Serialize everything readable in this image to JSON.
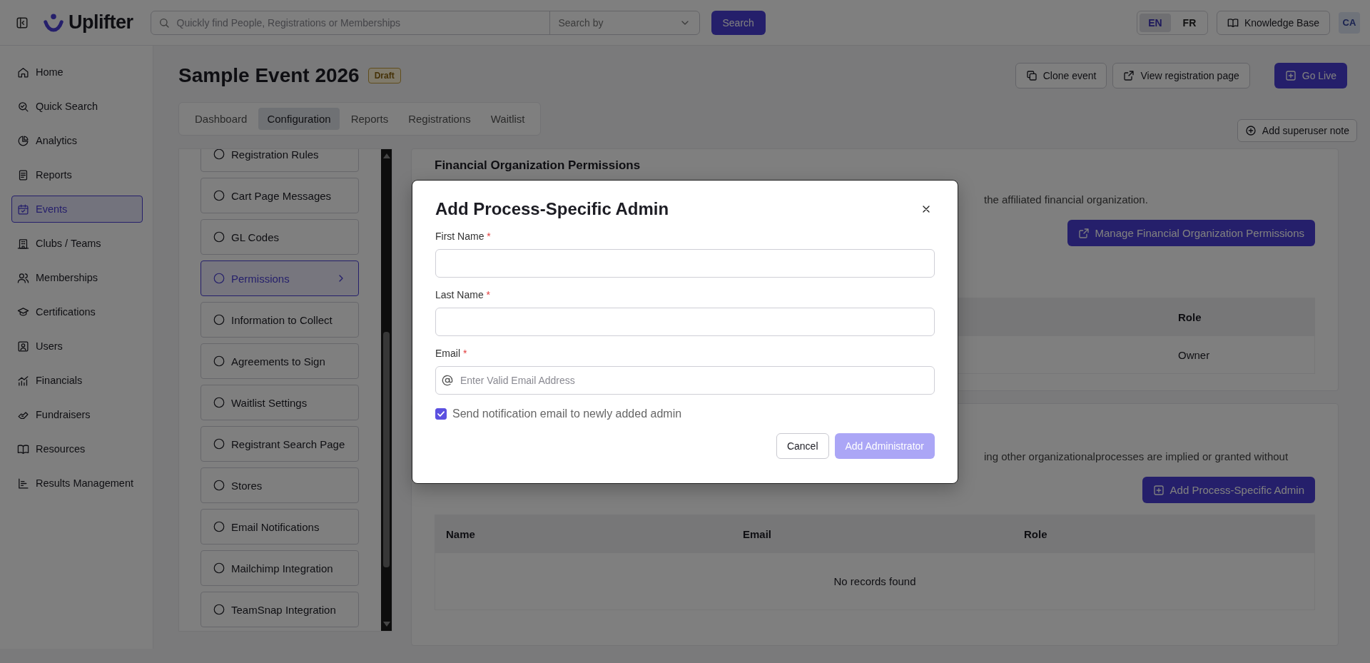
{
  "top_bar": {
    "logo": "Uplifter",
    "search": {
      "placeholder": "Quickly find People, Registrations or Memberships"
    },
    "search_by": {
      "placeholder": "Search by"
    },
    "search_button": "Search",
    "languages": [
      {
        "label": "EN",
        "selected": true
      },
      {
        "label": "FR",
        "selected": false
      }
    ],
    "help_link": "Knowledge Base",
    "avatar": "CA"
  },
  "sidebar": {
    "items": [
      {
        "label": "Home",
        "selected": false
      },
      {
        "label": "Quick Search",
        "selected": false
      },
      {
        "label": "Analytics",
        "selected": false
      },
      {
        "label": "Reports",
        "selected": false
      },
      {
        "label": "Events",
        "selected": true
      },
      {
        "label": "Clubs / Teams",
        "selected": false
      },
      {
        "label": "Memberships",
        "selected": false
      },
      {
        "label": "Certifications",
        "selected": false
      },
      {
        "label": "Users",
        "selected": false
      },
      {
        "label": "Financials",
        "selected": false
      },
      {
        "label": "Fundraisers",
        "selected": false
      },
      {
        "label": "Resources",
        "selected": false
      },
      {
        "label": "Results Management",
        "selected": false
      }
    ]
  },
  "event": {
    "title": "Sample Event 2026",
    "status": "Draft",
    "actions": [
      {
        "label": "Clone event",
        "kind": "clone"
      },
      {
        "label": "View registration page",
        "kind": "external"
      },
      {
        "label": "Go Live",
        "kind": "primary"
      }
    ],
    "tabs": [
      {
        "label": "Dashboard",
        "selected": false
      },
      {
        "label": "Configuration",
        "selected": true
      },
      {
        "label": "Reports",
        "selected": false
      },
      {
        "label": "Registrations",
        "selected": false
      },
      {
        "label": "Waitlist",
        "selected": false
      }
    ],
    "note_button": "Add superuser note"
  },
  "config_menu": {
    "items": [
      {
        "label": "Registration Rules",
        "selected": false
      },
      {
        "label": "Cart Page Messages",
        "selected": false
      },
      {
        "label": "GL Codes",
        "selected": false
      },
      {
        "label": "Permissions",
        "selected": true
      },
      {
        "label": "Information to Collect",
        "selected": false
      },
      {
        "label": "Agreements to Sign",
        "selected": false
      },
      {
        "label": "Waitlist Settings",
        "selected": false
      },
      {
        "label": "Registrant Search Page",
        "selected": false
      },
      {
        "label": "Stores",
        "selected": false
      },
      {
        "label": "Email Notifications",
        "selected": false
      },
      {
        "label": "Mailchimp Integration",
        "selected": false
      },
      {
        "label": "TeamSnap Integration",
        "selected": false
      }
    ]
  },
  "financial_section": {
    "title": "Financial Organization Permissions",
    "description": "the affiliated financial organization.",
    "button": "Manage Financial Organization Permissions",
    "table": {
      "columns": [
        "Role"
      ],
      "rows": [
        [
          "Owner"
        ]
      ]
    }
  },
  "process_section": {
    "description": "ing other organizationalprocesses are implied or granted without",
    "button": "Add Process-Specific Admin",
    "table": {
      "columns": [
        "Name",
        "Email",
        "Role"
      ],
      "empty_text": "No records found"
    }
  },
  "dialog": {
    "title": "Add Process-Specific Admin",
    "fields": [
      {
        "label": "First Name",
        "required_mark": "*"
      },
      {
        "label": "Last Name",
        "required_mark": "*"
      },
      {
        "label": "Email",
        "required_mark": "*",
        "placeholder": "Enter Valid Email Address",
        "kind": "email"
      }
    ],
    "notify": {
      "label": "Send notification email to newly added admin",
      "checked": true
    },
    "buttons": [
      {
        "label": "Cancel",
        "kind": "secondary",
        "disabled": false
      },
      {
        "label": "Add Administrator",
        "kind": "primary",
        "disabled": true
      }
    ]
  }
}
